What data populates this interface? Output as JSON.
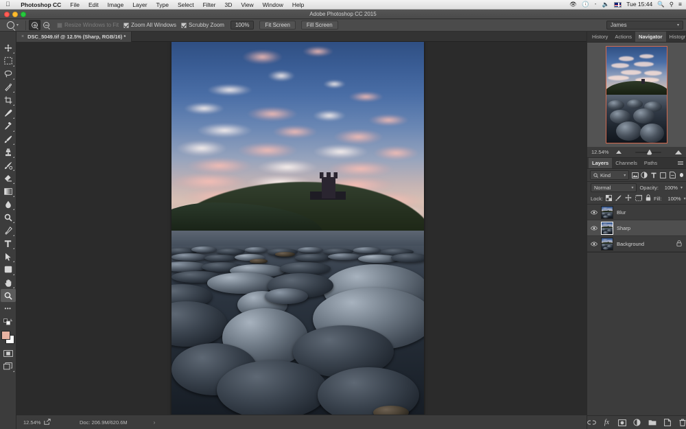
{
  "macbar": {
    "apple_icon": "apple-icon",
    "app_name": "Photoshop CC",
    "menus": [
      "File",
      "Edit",
      "Image",
      "Layer",
      "Type",
      "Select",
      "Filter",
      "3D",
      "View",
      "Window",
      "Help"
    ],
    "status_icons": [
      "display-icon",
      "time-machine-icon",
      "bluetooth-icon",
      "volume-icon",
      "uk-flag-icon"
    ],
    "clock": "Tue 15:44",
    "right_icons": [
      "binoculars-icon",
      "spotlight-search-icon",
      "notification-center-icon"
    ]
  },
  "window": {
    "title": "Adobe Photoshop CC 2015",
    "traffic_lights": [
      "close",
      "minimize",
      "zoom"
    ]
  },
  "options_bar": {
    "tool_icon": "zoom-tool-icon",
    "zoom_in_label": "zoom-in",
    "zoom_out_label": "zoom-out",
    "resize_windows_label": "Resize Windows to Fit",
    "resize_windows_checked": false,
    "resize_windows_enabled": false,
    "zoom_all_label": "Zoom All Windows",
    "zoom_all_checked": true,
    "scrubby_label": "Scrubby Zoom",
    "scrubby_checked": true,
    "zoom_value": "100%",
    "fit_screen_label": "Fit Screen",
    "fill_screen_label": "Fill Screen",
    "workspace": "James"
  },
  "document": {
    "tab_title": "DSC_5049.tif @ 12.5% (Sharp, RGB/16) *",
    "close_glyph": "×"
  },
  "toolbar": {
    "tools": [
      {
        "name": "move-tool",
        "selected": false
      },
      {
        "name": "rectangular-marquee-tool",
        "selected": false
      },
      {
        "name": "lasso-tool",
        "selected": false
      },
      {
        "name": "quick-selection-tool",
        "selected": false
      },
      {
        "name": "crop-tool",
        "selected": false
      },
      {
        "name": "eyedropper-tool",
        "selected": false
      },
      {
        "name": "spot-healing-brush-tool",
        "selected": false
      },
      {
        "name": "brush-tool",
        "selected": false
      },
      {
        "name": "clone-stamp-tool",
        "selected": false
      },
      {
        "name": "history-brush-tool",
        "selected": false
      },
      {
        "name": "eraser-tool",
        "selected": false
      },
      {
        "name": "gradient-tool",
        "selected": false
      },
      {
        "name": "blur-tool",
        "selected": false
      },
      {
        "name": "dodge-tool",
        "selected": false
      },
      {
        "name": "pen-tool",
        "selected": false
      },
      {
        "name": "type-tool",
        "selected": false
      },
      {
        "name": "path-selection-tool",
        "selected": false
      },
      {
        "name": "rectangle-tool",
        "selected": false
      },
      {
        "name": "hand-tool",
        "selected": false
      },
      {
        "name": "zoom-tool",
        "selected": true
      }
    ],
    "more_tools_glyph": "•••",
    "foreground_color": "#e8b3a2",
    "background_color": "#ffffff"
  },
  "status_bar": {
    "zoom": "12.54%",
    "doc_info": "Doc: 206.9M/620.6M",
    "expand_glyph": "›"
  },
  "navigator": {
    "tabs": [
      {
        "label": "History",
        "active": false
      },
      {
        "label": "Actions",
        "active": false
      },
      {
        "label": "Navigator",
        "active": true
      },
      {
        "label": "Histogr",
        "active": false
      }
    ],
    "zoom": "12.54%",
    "view_box_color": "#d46a4f"
  },
  "layers_panel": {
    "tabs": [
      {
        "label": "Layers",
        "active": true
      },
      {
        "label": "Channels",
        "active": false
      },
      {
        "label": "Paths",
        "active": false
      }
    ],
    "filter_kind": "Kind",
    "filter_icons": [
      "pixel-filter-icon",
      "adjustment-filter-icon",
      "type-filter-icon",
      "shape-filter-icon",
      "smart-object-filter-icon"
    ],
    "blend_mode": "Normal",
    "opacity_label": "Opacity:",
    "opacity_value": "100%",
    "lock_label": "Lock:",
    "lock_icons": [
      "lock-transparent-pixels-icon",
      "lock-image-pixels-icon",
      "lock-position-icon",
      "lock-artboard-nesting-icon",
      "lock-all-icon"
    ],
    "fill_label": "Fill:",
    "fill_value": "100%",
    "layers": [
      {
        "name": "Blur",
        "visible": true,
        "selected": false,
        "locked": false
      },
      {
        "name": "Sharp",
        "visible": true,
        "selected": true,
        "locked": false
      },
      {
        "name": "Background",
        "visible": true,
        "selected": false,
        "locked": true
      }
    ],
    "bottom_buttons": [
      "link-layers-icon",
      "add-layer-style-icon",
      "add-layer-mask-icon",
      "new-adjustment-layer-icon",
      "new-group-icon",
      "new-layer-icon",
      "delete-layer-icon"
    ]
  },
  "canvas": {
    "image_subject": "Dunstanburgh Castle over boulder beach at dusk",
    "zoom_percent": "12.5%"
  }
}
